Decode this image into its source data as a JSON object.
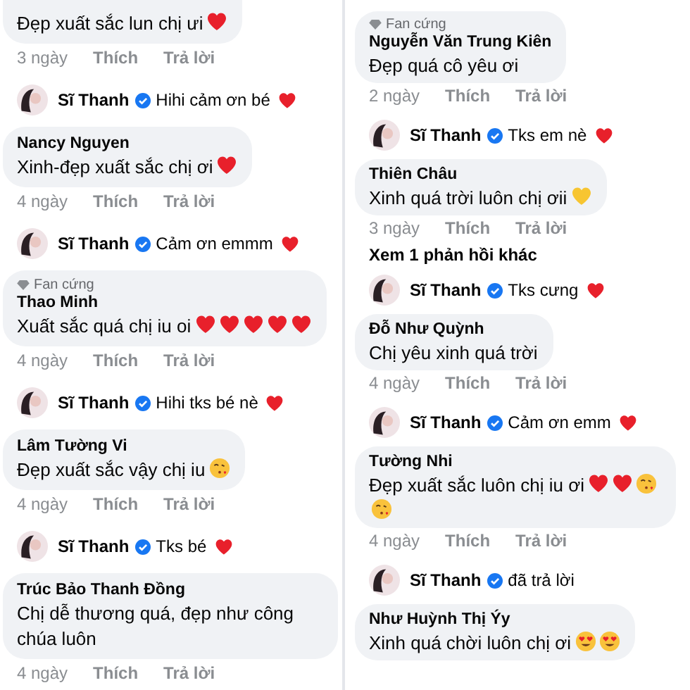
{
  "columns": [
    {
      "items": [
        {
          "kind": "comment",
          "text": "Đẹp xuất sắc lun chị ưi",
          "emojis": [
            {
              "kind": "heart"
            }
          ],
          "time": "3 ngày",
          "like": "Thích",
          "reply": "Trả lời"
        },
        {
          "kind": "reply",
          "author": "Sĩ Thanh",
          "verified": true,
          "text": "Hihi cảm ơn bé",
          "emojis": [
            {
              "kind": "heart"
            }
          ]
        },
        {
          "kind": "comment",
          "name": "Nancy Nguyen",
          "text": "Xinh-đẹp xuất sắc chị ơi",
          "emojis": [
            {
              "kind": "heart"
            }
          ],
          "time": "4 ngày",
          "like": "Thích",
          "reply": "Trả lời"
        },
        {
          "kind": "reply",
          "author": "Sĩ Thanh",
          "verified": true,
          "text": "Cảm ơn emmm",
          "emojis": [
            {
              "kind": "heart"
            }
          ]
        },
        {
          "kind": "comment",
          "badge": "Fan cứng",
          "name": "Thao Minh",
          "text": "Xuất sắc quá chị iu oi",
          "emojis": [
            {
              "kind": "heart"
            },
            {
              "kind": "heart"
            },
            {
              "kind": "heart"
            },
            {
              "kind": "heart"
            },
            {
              "kind": "heart"
            }
          ],
          "time": "4 ngày",
          "like": "Thích",
          "reply": "Trả lời"
        },
        {
          "kind": "reply",
          "author": "Sĩ Thanh",
          "verified": true,
          "text": "Hihi tks bé nè",
          "emojis": [
            {
              "kind": "heart"
            }
          ]
        },
        {
          "kind": "comment",
          "name": "Lâm Tường Vi",
          "text": "Đẹp xuất sắc vậy chị iu",
          "emojis": [
            {
              "kind": "kiss"
            }
          ],
          "time": "4 ngày",
          "like": "Thích",
          "reply": "Trả lời"
        },
        {
          "kind": "reply",
          "author": "Sĩ Thanh",
          "verified": true,
          "text": "Tks bé",
          "emojis": [
            {
              "kind": "heart"
            }
          ]
        },
        {
          "kind": "comment",
          "name": "Trúc Bảo Thanh Đồng",
          "text": "Chị dễ thương quá, đẹp như công chúa luôn",
          "time": "4 ngày",
          "like": "Thích",
          "reply": "Trả lời"
        }
      ]
    },
    {
      "items": [
        {
          "kind": "comment",
          "badge": "Fan cứng",
          "name": "Nguyễn Văn Trung Kiên",
          "text": "Đẹp quá cô yêu ơi",
          "time": "2 ngày",
          "like": "Thích",
          "reply": "Trả lời"
        },
        {
          "kind": "reply",
          "author": "Sĩ Thanh",
          "verified": true,
          "text": "Tks em nè",
          "emojis": [
            {
              "kind": "heart"
            }
          ]
        },
        {
          "kind": "comment",
          "name": "Thiên Châu",
          "text": "Xinh quá trời luôn chị ơii",
          "emojis": [
            {
              "kind": "yellow-heart"
            }
          ],
          "time": "3 ngày",
          "like": "Thích",
          "reply": "Trả lời"
        },
        {
          "kind": "more",
          "text": "Xem 1 phản hồi khác"
        },
        {
          "kind": "reply",
          "author": "Sĩ Thanh",
          "verified": true,
          "text": "Tks cưng",
          "emojis": [
            {
              "kind": "heart"
            }
          ]
        },
        {
          "kind": "comment",
          "name": "Đỗ Như Quỳnh",
          "text": "Chị yêu xinh quá trời",
          "time": "4 ngày",
          "like": "Thích",
          "reply": "Trả lời"
        },
        {
          "kind": "reply",
          "author": "Sĩ Thanh",
          "verified": true,
          "text": "Cảm ơn emm",
          "emojis": [
            {
              "kind": "heart"
            }
          ]
        },
        {
          "kind": "comment",
          "name": "Tường Nhi",
          "text": "Đẹp xuất sắc luôn chị iu ơi",
          "emojis": [
            {
              "kind": "heart"
            },
            {
              "kind": "heart"
            },
            {
              "kind": "kiss"
            },
            {
              "kind": "kiss"
            }
          ],
          "time": "4 ngày",
          "like": "Thích",
          "reply": "Trả lời"
        },
        {
          "kind": "reply",
          "author": "Sĩ Thanh",
          "verified": true,
          "text": "đã trả lời"
        },
        {
          "kind": "comment",
          "name": "Như Huỳnh Thị Ýy",
          "text": "Xinh quá chời luôn chị ơi",
          "emojis": [
            {
              "kind": "heart-eyes"
            },
            {
              "kind": "heart-eyes"
            }
          ]
        }
      ]
    }
  ]
}
